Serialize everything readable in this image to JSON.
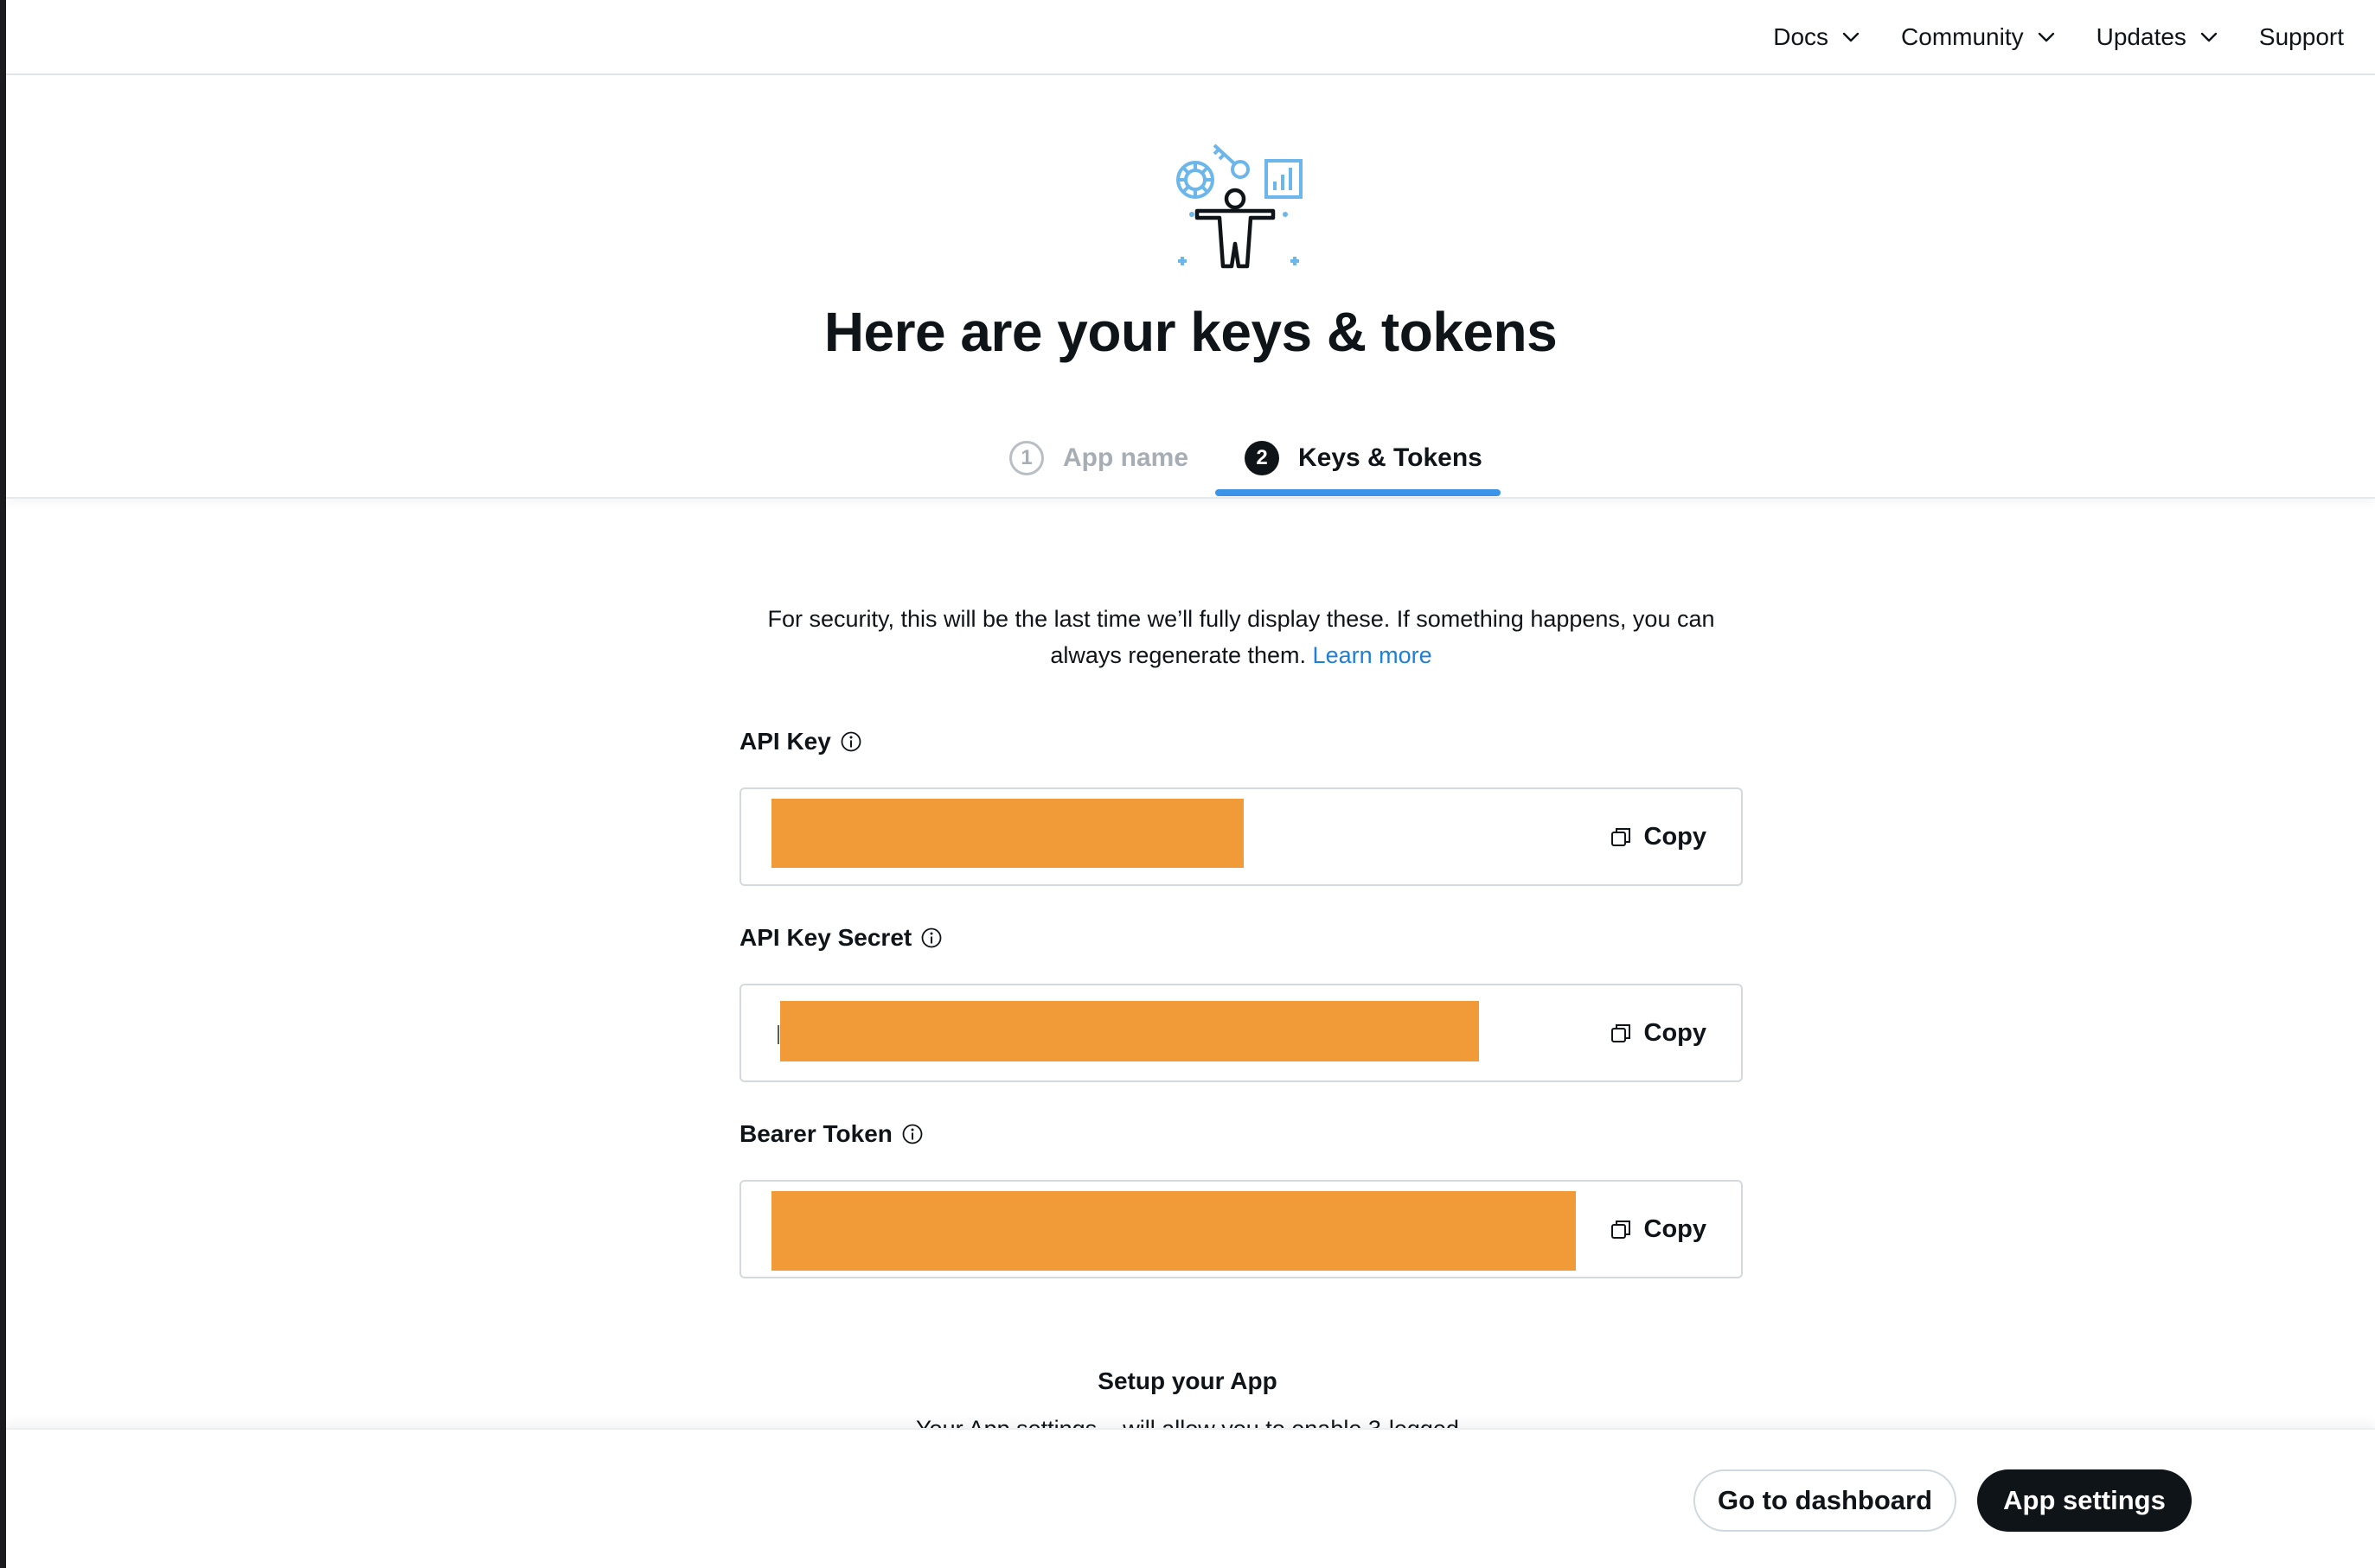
{
  "nav": {
    "items": [
      {
        "label": "Docs",
        "has_menu": true
      },
      {
        "label": "Community",
        "has_menu": true
      },
      {
        "label": "Updates",
        "has_menu": true
      },
      {
        "label": "Support",
        "has_menu": false
      }
    ]
  },
  "hero": {
    "title": "Here are your keys & tokens",
    "illustration_icon": "developer-keys-illustration-icon"
  },
  "steps": [
    {
      "number": "1",
      "label": "App name",
      "state": "complete"
    },
    {
      "number": "2",
      "label": "Keys & Tokens",
      "state": "active"
    }
  ],
  "notice": {
    "line1": "For security, this will be the last time we’ll fully display these. If something happens, you can",
    "line2": "always regenerate them.",
    "link": "Learn more"
  },
  "fields": [
    {
      "label": "API Key",
      "copy_label": "Copy",
      "value_redacted": true
    },
    {
      "label": "API Key Secret",
      "copy_label": "Copy",
      "value_redacted": true
    },
    {
      "label": "Bearer Token",
      "copy_label": "Copy",
      "value_redacted": true
    }
  ],
  "setup": {
    "title": "Setup your App",
    "text": "Your App settings... will allow you to enable 3-legged"
  },
  "footer": {
    "dashboard_label": "Go to dashboard",
    "settings_label": "App settings"
  },
  "colors": {
    "accent": "#3b94e8",
    "link": "#1d7fd6",
    "redaction": "#f09a38",
    "primary_button": "#0f1419"
  }
}
